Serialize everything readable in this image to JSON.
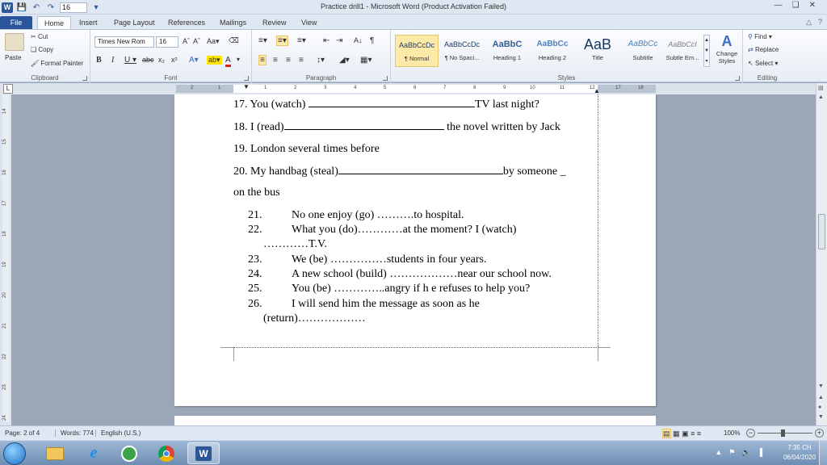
{
  "titlebar": {
    "title": "Practice drill1  -  Microsoft Word (Product Activation Failed)",
    "font_size": "16"
  },
  "tabs": [
    "File",
    "Home",
    "Insert",
    "Page Layout",
    "References",
    "Mailings",
    "Review",
    "View"
  ],
  "ribbon": {
    "clipboard": {
      "paste": "Paste",
      "cut": "Cut",
      "copy": "Copy",
      "format_painter": "Format Painter",
      "label": "Clipboard"
    },
    "font": {
      "name": "Times New Rom",
      "size": "16",
      "label": "Font"
    },
    "paragraph": {
      "label": "Paragraph"
    },
    "styles": {
      "label": "Styles",
      "items": [
        {
          "preview": "AaBbCcDc",
          "name": "¶ Normal"
        },
        {
          "preview": "AaBbCcDc",
          "name": "¶ No Spaci..."
        },
        {
          "preview": "AaBbC",
          "name": "Heading 1"
        },
        {
          "preview": "AaBbCc",
          "name": "Heading 2"
        },
        {
          "preview": "AaB",
          "name": "Title"
        },
        {
          "preview": "AaBbCc",
          "name": "Subtitle"
        },
        {
          "preview": "AaBbCcI",
          "name": "Subtle Em..."
        }
      ],
      "change_styles": "Change Styles"
    },
    "editing": {
      "find": "Find",
      "replace": "Replace",
      "select": "Select",
      "label": "Editing"
    }
  },
  "document": {
    "lines": [
      {
        "pre": "17. You (watch) ",
        "post": "TV last night?"
      },
      {
        "pre": "18. I (read)",
        "post": " the novel written by Jack"
      },
      {
        "pre": "19. London several times before",
        "post": ""
      },
      {
        "pre": "20. My handbag (steal)",
        "post": "by someone _"
      },
      {
        "pre": "on the bus",
        "post": ""
      }
    ],
    "numbered": [
      {
        "num": "21.",
        "text": "No one enjoy (go) ……….to  hospital."
      },
      {
        "num": "22.",
        "text": "What you (do)…………at the moment? I (watch)"
      },
      {
        "num": "",
        "text": "…………T.V."
      },
      {
        "num": "23.",
        "text": "We (be) ……………students in four years."
      },
      {
        "num": "24.",
        "text": "A new school (build) ………………near  our school now."
      },
      {
        "num": "25.",
        "text": "You (be) …………..angry  if h e refuses to help you?"
      },
      {
        "num": "26.",
        "text": "I will send him the message  as soon as he"
      },
      {
        "num": "",
        "text": "(return)………………"
      }
    ]
  },
  "status": {
    "page": "Page: 2 of 4",
    "words": "Words: 774",
    "language": "English (U.S.)",
    "zoom": "100%"
  },
  "taskbar": {
    "time": "7:35 CH",
    "date": "06/04/2020"
  }
}
